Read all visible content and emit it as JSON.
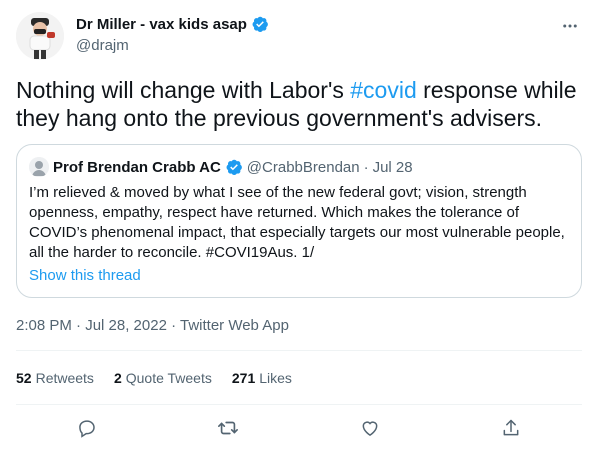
{
  "author": {
    "display_name": "Dr Miller - vax kids asap",
    "handle": "@drajm",
    "verified": true
  },
  "tweet": {
    "text_before": "Nothing will change with Labor's ",
    "hashtag": "#covid",
    "text_after": " response while they hang onto the previous government's advisers."
  },
  "quote": {
    "display_name": "Prof Brendan Crabb AC",
    "handle": "@CrabbBrendan",
    "separator": "·",
    "date": "Jul 28",
    "text": "I’m relieved & moved by what I see of the new federal govt; vision, strength openness, empathy, respect have returned. Which makes the tolerance of COVID’s phenomenal impact, that especially targets our most vulnerable people, all the harder to reconcile. #COVI19Aus. 1/",
    "show_thread": "Show this thread"
  },
  "meta": {
    "timestamp": "2:08 PM · Jul 28, 2022 · Twitter Web App"
  },
  "stats": {
    "retweets_count": "52",
    "retweets_label": "Retweets",
    "quotes_count": "2",
    "quotes_label": "Quote Tweets",
    "likes_count": "271",
    "likes_label": "Likes"
  },
  "icons": {
    "more": "more-horizontal-icon",
    "reply": "reply-icon",
    "retweet": "retweet-icon",
    "like": "heart-icon",
    "share": "share-icon",
    "verified": "verified-badge-icon"
  },
  "colors": {
    "accent": "#1d9bf0",
    "text": "#0f1419",
    "secondary": "#536471",
    "border": "#cfd9de"
  }
}
